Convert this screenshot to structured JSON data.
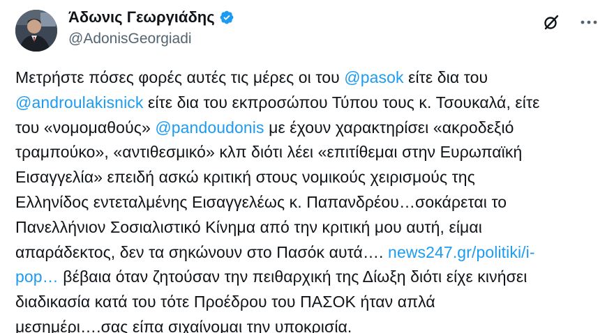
{
  "author": {
    "display_name": "Άδωνις Γεωργιάδης",
    "handle": "@AdonisGeorgiadi",
    "verified": true
  },
  "icons": {
    "verified": "verified-badge-icon",
    "grok": "grok-icon",
    "more": "more-options-icon"
  },
  "colors": {
    "link": "#1d9bf0",
    "verified": "#1d9bf0",
    "text": "#0f1419",
    "secondary": "#536471"
  },
  "tweet": {
    "lines": [
      [
        {
          "text": "Μετρήστε πόσες φορές αυτές τις μέρες οι του "
        },
        {
          "text": "@pasok",
          "link": true
        },
        {
          "text": " είτε δια του"
        }
      ],
      [
        {
          "text": "@androulakisnick",
          "link": true
        },
        {
          "text": " είτε δια του εκπροσώπου Τύπου τους κ. Τσουκαλά, είτε"
        }
      ],
      [
        {
          "text": "του «νομομαθούς» "
        },
        {
          "text": "@pandoudonis",
          "link": true
        },
        {
          "text": " με έχουν χαρακτηρίσει «ακροδεξιό"
        }
      ],
      [
        {
          "text": "τραμπούκο», «αντιθεσμικό» κλπ διότι λέει «επιτίθεμαι στην Ευρωπαϊκή"
        }
      ],
      [
        {
          "text": "Εισαγγελία» επειδή ασκώ κριτική στους νομικούς χειρισμούς της"
        }
      ],
      [
        {
          "text": "Ελληνίδος εντεταλμένης Εισαγγελέως κ. Παπανδρέου…σοκάρεται το"
        }
      ],
      [
        {
          "text": "Πανελλήνιον Σοσιαλιστικό Κίνημα από την κριτική μου αυτή, είμαι"
        }
      ],
      [
        {
          "text": "απαράδεκτος, δεν τα σηκώνουν στο Πασόκ αυτά…. "
        },
        {
          "text": "news247.gr/politiki/i-",
          "link": true
        }
      ],
      [
        {
          "text": "pop…",
          "link": true
        },
        {
          "text": " βέβαια όταν ζητούσαν την πειθαρχική της Δίωξη διότι είχε κινήσει"
        }
      ],
      [
        {
          "text": "διαδικασία κατά του τότε Προέδρου του ΠΑΣΟΚ ήταν απλά"
        }
      ],
      [
        {
          "text": "μεσημέρι….σας είπα σιχαίνομαι την υποκρισία."
        }
      ]
    ]
  }
}
